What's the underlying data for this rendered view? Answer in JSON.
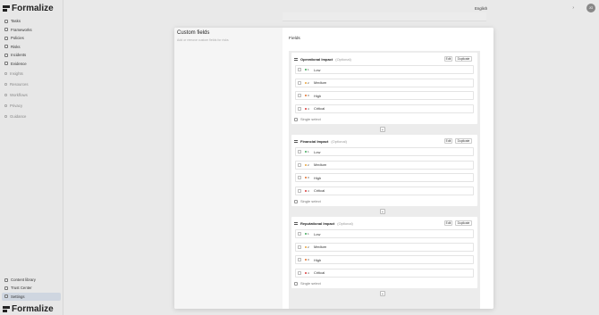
{
  "brand": {
    "name": "Formalize"
  },
  "sidebar": {
    "items": [
      {
        "label": "Tasks"
      },
      {
        "label": "Frameworks"
      },
      {
        "label": "Policies"
      },
      {
        "label": "Risks"
      },
      {
        "label": "Incidents"
      },
      {
        "label": "Evidence"
      }
    ],
    "muted_items": [
      {
        "label": "Insights"
      },
      {
        "label": "Resources"
      },
      {
        "label": "Workflows"
      },
      {
        "label": "Privacy"
      },
      {
        "label": "Guidance"
      }
    ],
    "bottom_items": [
      {
        "label": "Content library"
      },
      {
        "label": "Trust Center"
      },
      {
        "label": "Settings"
      }
    ]
  },
  "topbar": {
    "language": "English",
    "avatar_initials": "JG"
  },
  "modal": {
    "title": "Custom fields",
    "subtitle": "Add or remove custom fields for risks",
    "fields_title": "Fields",
    "edit_label": "Edit",
    "duplicate_label": "Duplicate",
    "footer_label": "Single select",
    "add_label": "+",
    "groups": [
      {
        "title": "Operational Impact",
        "optional": "(Optional)",
        "options": [
          {
            "num": "1",
            "label": "Low"
          },
          {
            "num": "2",
            "label": "Medium"
          },
          {
            "num": "3",
            "label": "High"
          },
          {
            "num": "4",
            "label": "Critical"
          }
        ]
      },
      {
        "title": "Financial Impact",
        "optional": "(Optional)",
        "options": [
          {
            "num": "1",
            "label": "Low"
          },
          {
            "num": "2",
            "label": "Medium"
          },
          {
            "num": "3",
            "label": "High"
          },
          {
            "num": "4",
            "label": "Critical"
          }
        ]
      },
      {
        "title": "Reputational Impact",
        "optional": "(Optional)",
        "options": [
          {
            "num": "1",
            "label": "Low"
          },
          {
            "num": "2",
            "label": "Medium"
          },
          {
            "num": "3",
            "label": "High"
          },
          {
            "num": "4",
            "label": "Critical"
          }
        ]
      }
    ]
  },
  "colors": {
    "low": "#3aa757",
    "medium": "#e8a33a",
    "high": "#e2702a",
    "critical": "#d93a3a"
  }
}
